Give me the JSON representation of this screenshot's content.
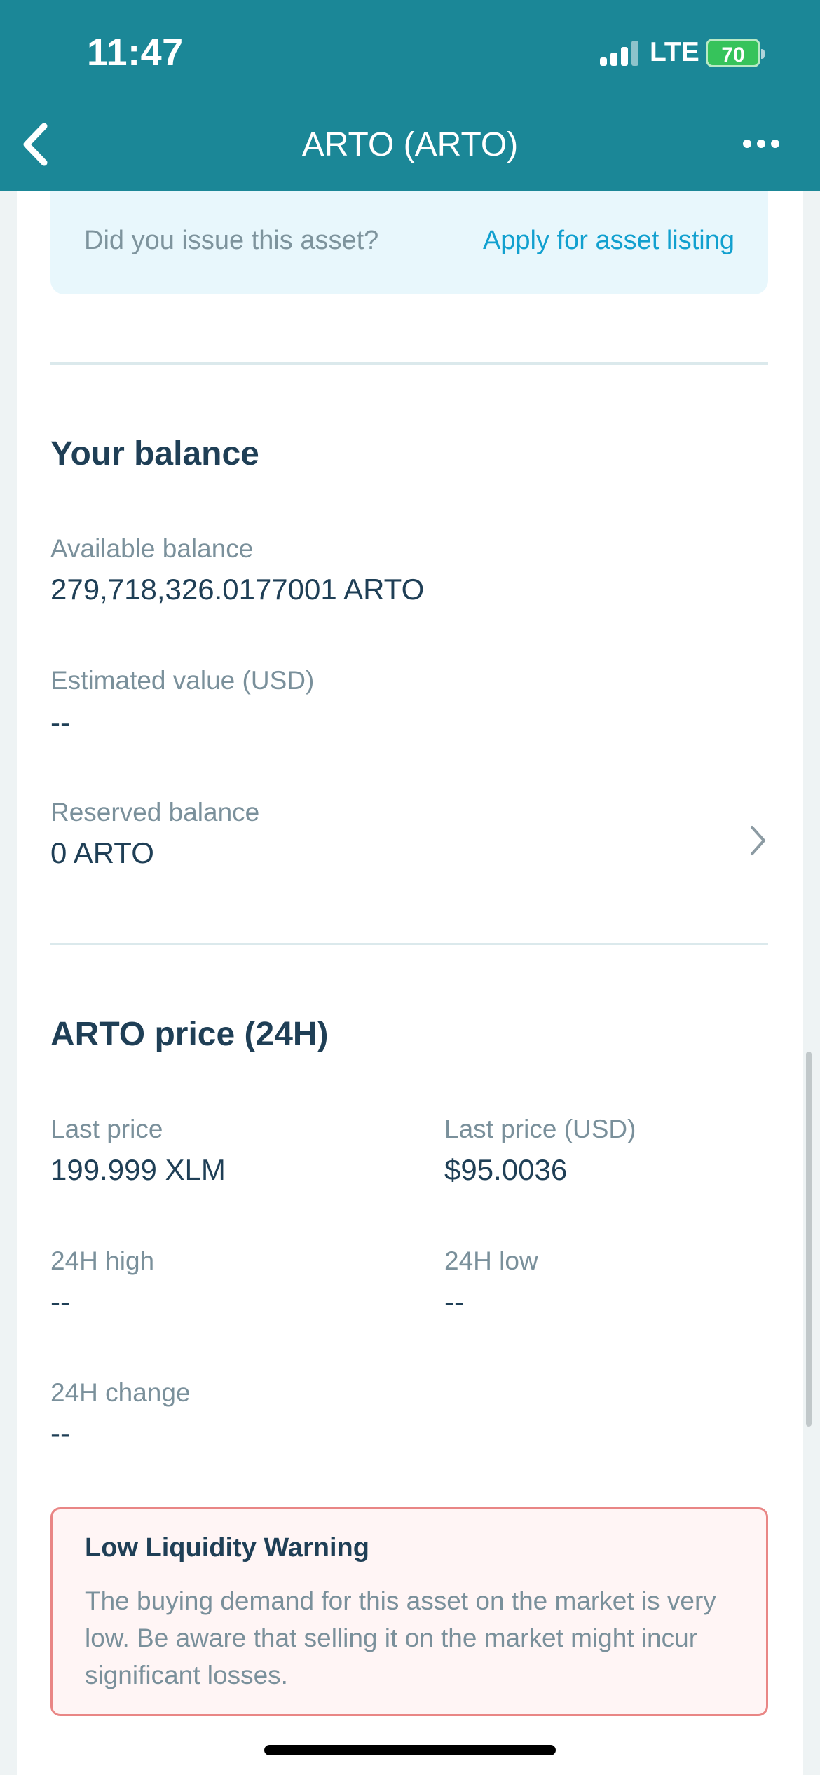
{
  "status_bar": {
    "time": "11:47",
    "network": "LTE",
    "battery": "70"
  },
  "nav": {
    "title": "ARTO (ARTO)",
    "back_icon": "chevron-left-icon",
    "more_icon": "more-horizontal-icon"
  },
  "asset_banner": {
    "question": "Did you issue this asset?",
    "action": "Apply for asset listing"
  },
  "balance": {
    "title": "Your balance",
    "available_label": "Available balance",
    "available_value": "279,718,326.0177001 ARTO",
    "estimated_label": "Estimated value (USD)",
    "estimated_value": "--",
    "reserved_label": "Reserved balance",
    "reserved_value": "0 ARTO"
  },
  "price": {
    "title": "ARTO price (24H)",
    "last_label": "Last price",
    "last_value": "199.999 XLM",
    "last_usd_label": "Last price (USD)",
    "last_usd_value": "$95.0036",
    "high_label": "24H high",
    "high_value": "--",
    "low_label": "24H low",
    "low_value": "--",
    "change_label": "24H change",
    "change_value": "--"
  },
  "warning": {
    "title": "Low Liquidity Warning",
    "body": "The buying demand for this asset on the market is very low. Be aware that selling it on the market might incur significant losses."
  },
  "colors": {
    "header": "#1b8797",
    "link": "#11a0cf",
    "warning_border": "#e98685",
    "battery": "#36c35b"
  }
}
